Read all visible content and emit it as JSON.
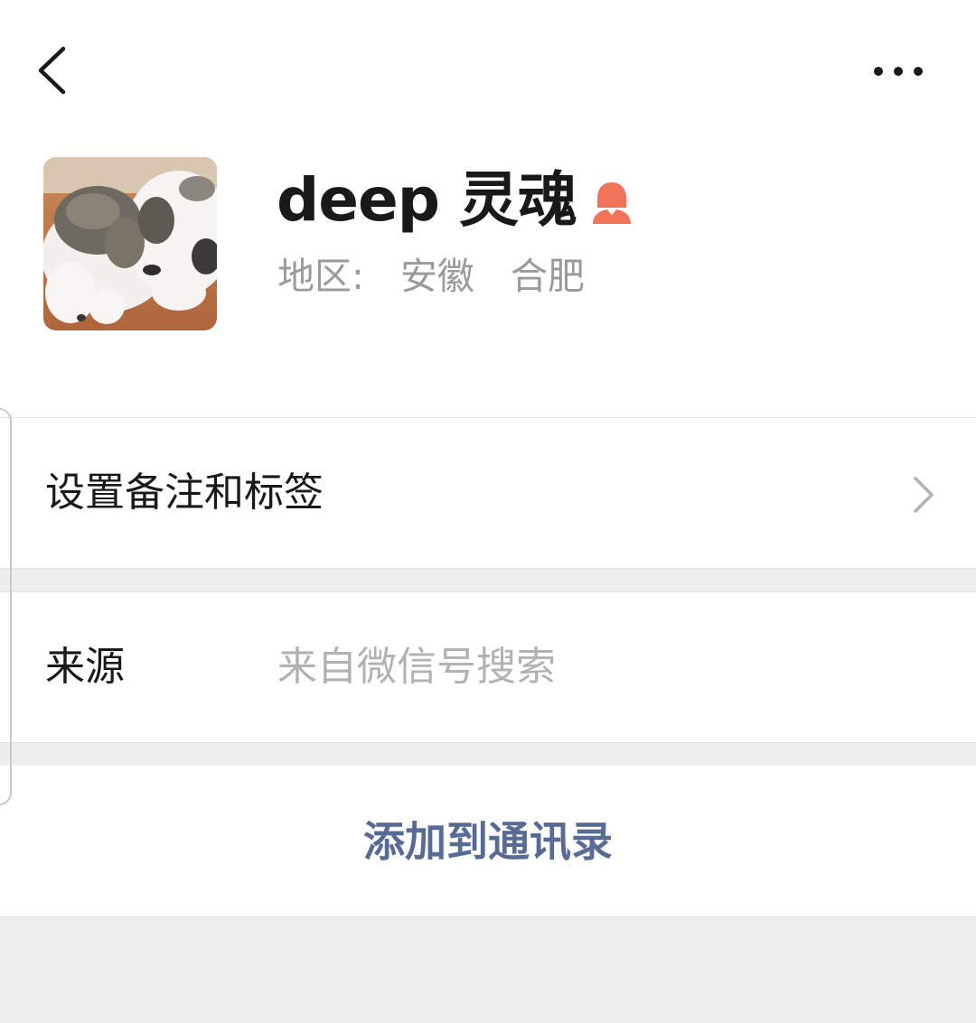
{
  "header": {
    "back_icon": "chevron-left-icon",
    "more_icon": "more-dots-icon"
  },
  "profile": {
    "avatar": "cat-photo-avatar",
    "name": "deep 灵魂",
    "gender_icon": "female-icon",
    "gender_color": "#f0735a",
    "region_label": "地区:",
    "region_province": "安徽",
    "region_city": "合肥"
  },
  "rows": {
    "remark_label": "设置备注和标签",
    "source_label": "来源",
    "source_value": "来自微信号搜索"
  },
  "actions": {
    "add_contact": "添加到通讯录",
    "link_color": "#576b95"
  }
}
